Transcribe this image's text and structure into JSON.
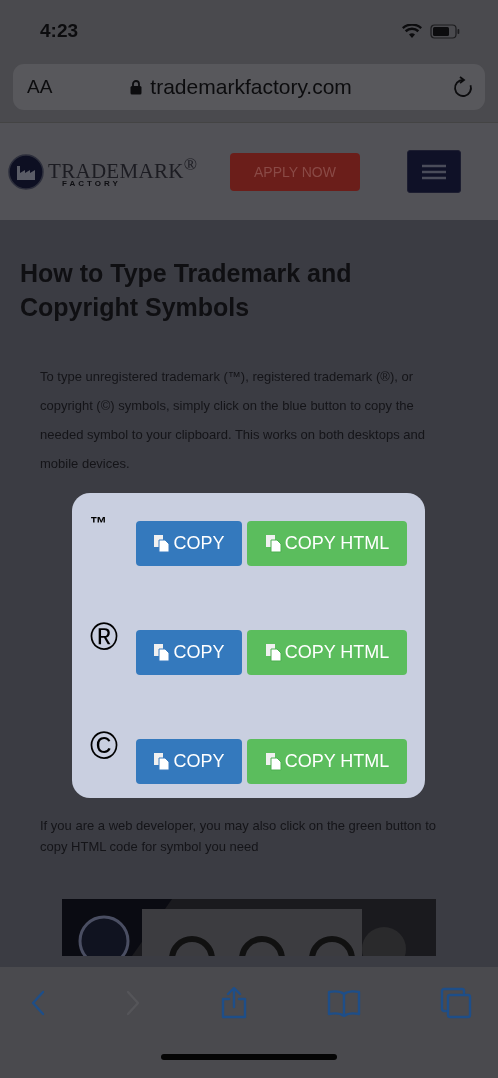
{
  "status_bar": {
    "time": "4:23"
  },
  "address_bar": {
    "reader_button": "AA",
    "url": "trademarkfactory.com"
  },
  "site_header": {
    "logo_name": "TRADEMARK$^{®}$",
    "logo_sub": "FACTORY",
    "apply_button": "APPLY NOW"
  },
  "article": {
    "title": "How to Type Trademark and Copyright Symbols",
    "intro": "To type unregistered trademark (™), registered trademark (®), or copyright (©) symbols, simply click on the blue button to copy the needed symbol to your clipboard. This works on both desktops and mobile devices.",
    "symbols": [
      {
        "symbol": "™",
        "copy_button": "COPY",
        "html_button": "COPY HTML"
      },
      {
        "symbol": "®",
        "copy_button": "COPY",
        "html_button": "COPY HTML"
      },
      {
        "symbol": "©",
        "copy_button": "COPY",
        "html_button": "COPY HTML"
      }
    ],
    "note": "If you are a web developer, you may also click on the green button to copy HTML code for symbol you need"
  },
  "toolbar": [
    {
      "kind": "back",
      "disabled": false
    },
    {
      "kind": "forward",
      "disabled": true
    },
    {
      "kind": "share",
      "disabled": false
    },
    {
      "kind": "bookmarks",
      "disabled": false
    },
    {
      "kind": "tabs",
      "disabled": false
    }
  ]
}
